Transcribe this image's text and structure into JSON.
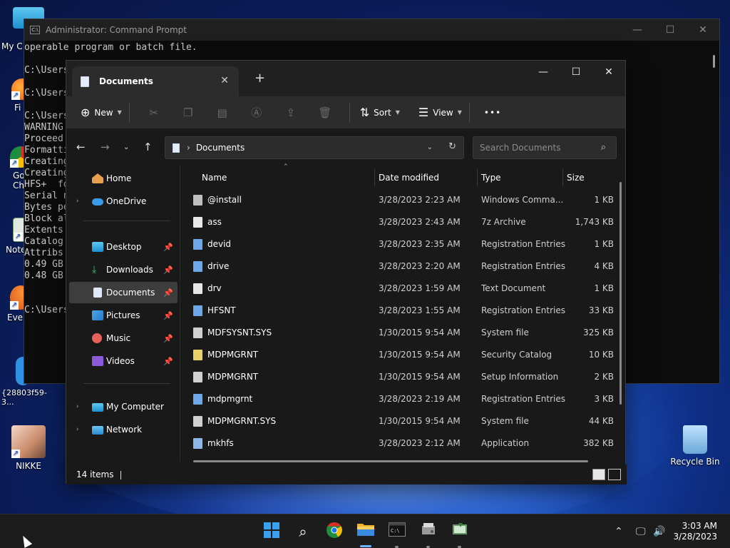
{
  "desktop": {
    "icons": [
      {
        "label": "My C",
        "icon": "computer-icon"
      },
      {
        "label": "Fi",
        "icon": "firefox-icon"
      },
      {
        "label": "Go\nCh",
        "icon": "chrome-icon"
      },
      {
        "label": "Note",
        "icon": "notepad-icon"
      },
      {
        "label": "Ever",
        "icon": "everything-icon"
      },
      {
        "label": "{28803f59-3...",
        "icon": "shortcut-icon"
      },
      {
        "label": "NIKKE",
        "icon": "nikke-icon"
      },
      {
        "label": "Recycle Bin",
        "icon": "recycle-bin-icon"
      }
    ]
  },
  "cmd": {
    "title": "Administrator: Command Prompt",
    "lines": [
      "operable program or batch file.",
      "",
      "C:\\Users",
      "",
      "C:\\Users",
      "",
      "C:\\Users",
      "WARNING",
      "Proceed",
      "Formatti",
      "Creating",
      "Creating",
      "HFS+  fo",
      "Serial n",
      "Bytes pe",
      "Block al",
      "Extents",
      "Catalog",
      "Attribs",
      "0.49 GB",
      "0.48 GB",
      "",
      "",
      "C:\\Users"
    ]
  },
  "explorer": {
    "tab_title": "Documents",
    "toolbar": {
      "new_label": "New",
      "sort_label": "Sort",
      "view_label": "View",
      "more_label": "•••"
    },
    "address": {
      "path": "Documents",
      "search_placeholder": "Search Documents"
    },
    "sidebar": {
      "home": "Home",
      "onedrive": "OneDrive",
      "desktop": "Desktop",
      "downloads": "Downloads",
      "documents": "Documents",
      "pictures": "Pictures",
      "music": "Music",
      "videos": "Videos",
      "my_computer": "My Computer",
      "network": "Network"
    },
    "columns": {
      "name": "Name",
      "date": "Date modified",
      "type": "Type",
      "size": "Size"
    },
    "files": [
      {
        "name": "@install",
        "date": "3/28/2023 2:23 AM",
        "type": "Windows Comma...",
        "size": "1 KB",
        "color": "#bfbfbf"
      },
      {
        "name": "ass",
        "date": "3/28/2023 2:43 AM",
        "type": "7z Archive",
        "size": "1,743 KB",
        "color": "#e8e8e8"
      },
      {
        "name": "devid",
        "date": "3/28/2023 2:35 AM",
        "type": "Registration Entries",
        "size": "1 KB",
        "color": "#6fa8e8"
      },
      {
        "name": "drive",
        "date": "3/28/2023 2:20 AM",
        "type": "Registration Entries",
        "size": "4 KB",
        "color": "#6fa8e8"
      },
      {
        "name": "drv",
        "date": "3/28/2023 1:59 AM",
        "type": "Text Document",
        "size": "1 KB",
        "color": "#e6e6e6"
      },
      {
        "name": "HFSNT",
        "date": "3/28/2023 1:55 AM",
        "type": "Registration Entries",
        "size": "33 KB",
        "color": "#6fa8e8"
      },
      {
        "name": "MDFSYSNT.SYS",
        "date": "1/30/2015 9:54 AM",
        "type": "System file",
        "size": "325 KB",
        "color": "#d0d0d0"
      },
      {
        "name": "MDPMGRNT",
        "date": "1/30/2015 9:54 AM",
        "type": "Security Catalog",
        "size": "10 KB",
        "color": "#e8d06a"
      },
      {
        "name": "MDPMGRNT",
        "date": "1/30/2015 9:54 AM",
        "type": "Setup Information",
        "size": "2 KB",
        "color": "#d0d0d0"
      },
      {
        "name": "mdpmgrnt",
        "date": "3/28/2023 2:19 AM",
        "type": "Registration Entries",
        "size": "3 KB",
        "color": "#6fa8e8"
      },
      {
        "name": "MDPMGRNT.SYS",
        "date": "1/30/2015 9:54 AM",
        "type": "System file",
        "size": "44 KB",
        "color": "#d0d0d0"
      },
      {
        "name": "mkhfs",
        "date": "3/28/2023 2:12 AM",
        "type": "Application",
        "size": "382 KB",
        "color": "#8fb8e8"
      }
    ],
    "status": "14 items"
  },
  "taskbar": {
    "time": "3:03 AM",
    "date": "3/28/2023"
  }
}
